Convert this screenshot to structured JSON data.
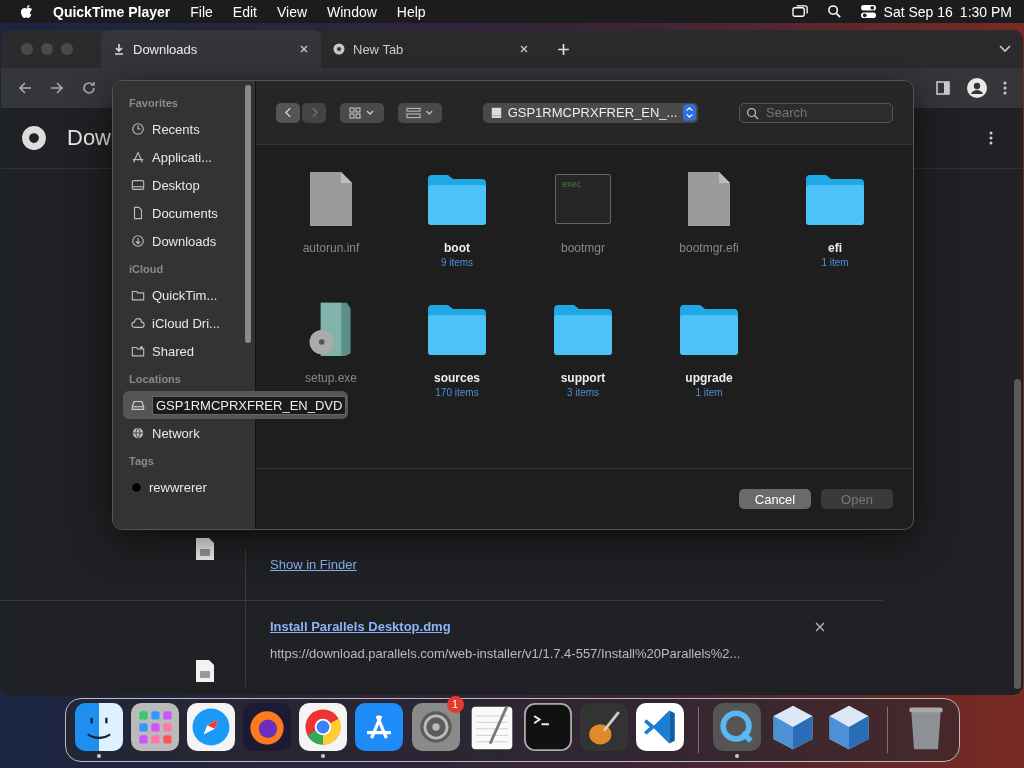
{
  "menu_bar": {
    "app_name": "QuickTime Player",
    "menus": [
      "File",
      "Edit",
      "View",
      "Window",
      "Help"
    ],
    "date": "Sat Sep 16",
    "time": "1:30 PM"
  },
  "browser": {
    "tabs": [
      {
        "label": "Downloads",
        "kind": "download",
        "selected": true
      },
      {
        "label": "New Tab",
        "kind": "chrome",
        "selected": false
      }
    ],
    "page_title": "Dow",
    "downloads": [
      {
        "kind": "partial",
        "link": "Show in Finder"
      },
      {
        "kind": "item",
        "name": "Install Parallels Desktop.dmg",
        "url": "https://download.parallels.com/web-installer/v1/1.7.4-557/Install%20Parallels%2..."
      }
    ]
  },
  "dialog": {
    "location": "GSP1RMCPRXFRER_EN_...",
    "search": {
      "placeholder": "Search"
    },
    "sidebar": [
      {
        "heading": "Favorites",
        "items": [
          {
            "label": "Recents",
            "kind": "clock",
            "selected": false
          },
          {
            "label": "Applicati...",
            "kind": "apps",
            "selected": false
          },
          {
            "label": "Desktop",
            "kind": "desktop",
            "selected": false
          },
          {
            "label": "Documents",
            "kind": "document",
            "selected": false
          },
          {
            "label": "Downloads",
            "kind": "download",
            "selected": false
          }
        ]
      },
      {
        "heading": "iCloud",
        "items": [
          {
            "label": "QuickTim...",
            "kind": "folder",
            "selected": false
          },
          {
            "label": "iCloud Dri...",
            "kind": "cloud",
            "selected": false
          },
          {
            "label": "Shared",
            "kind": "shared",
            "selected": false
          }
        ]
      },
      {
        "heading": "Locations",
        "items": [
          {
            "label": "GSP1RMCPRXFRER_EN_DVD",
            "kind": "drive",
            "selected": true
          },
          {
            "label": "Network",
            "kind": "globe",
            "selected": false
          }
        ]
      },
      {
        "heading": "Tags",
        "items": [
          {
            "label": "rewwrerer",
            "kind": "tag",
            "color": "#000000",
            "selected": false
          }
        ]
      }
    ],
    "files": [
      {
        "name": "autorun.inf",
        "kind": "file",
        "disabled": true
      },
      {
        "name": "boot",
        "count": "9 items",
        "kind": "folder",
        "disabled": false
      },
      {
        "name": "bootmgr",
        "kind": "exec",
        "icon_text": "exec",
        "disabled": true
      },
      {
        "name": "bootmgr.efi",
        "kind": "file",
        "disabled": true
      },
      {
        "name": "efi",
        "count": "1 item",
        "kind": "folder",
        "disabled": false
      },
      {
        "name": "setup.exe",
        "kind": "installer",
        "disabled": true
      },
      {
        "name": "sources",
        "count": "170 items",
        "kind": "folder",
        "disabled": false
      },
      {
        "name": "support",
        "count": "3 items",
        "kind": "folder",
        "disabled": false
      },
      {
        "name": "upgrade",
        "count": "1 item",
        "kind": "folder",
        "disabled": false
      }
    ],
    "buttons": [
      {
        "label": "Cancel",
        "disabled": false
      },
      {
        "label": "Open",
        "disabled": true
      }
    ]
  },
  "dock": [
    {
      "kind": "finder",
      "running": true
    },
    {
      "kind": "launchpad",
      "running": false
    },
    {
      "kind": "safari",
      "running": false
    },
    {
      "kind": "firefox",
      "running": false
    },
    {
      "kind": "chrome",
      "running": true
    },
    {
      "kind": "appstore",
      "running": false
    },
    {
      "kind": "settings",
      "running": false,
      "badge": "1"
    },
    {
      "kind": "textedit",
      "running": false
    },
    {
      "kind": "terminal",
      "running": false
    },
    {
      "kind": "guitar",
      "running": false
    },
    {
      "kind": "vscode",
      "running": false
    },
    {
      "kind": "separator"
    },
    {
      "kind": "quicktime",
      "running": true
    },
    {
      "kind": "cube",
      "running": false
    },
    {
      "kind": "cube",
      "running": false
    },
    {
      "kind": "separator"
    },
    {
      "kind": "trash",
      "running": false
    }
  ]
}
